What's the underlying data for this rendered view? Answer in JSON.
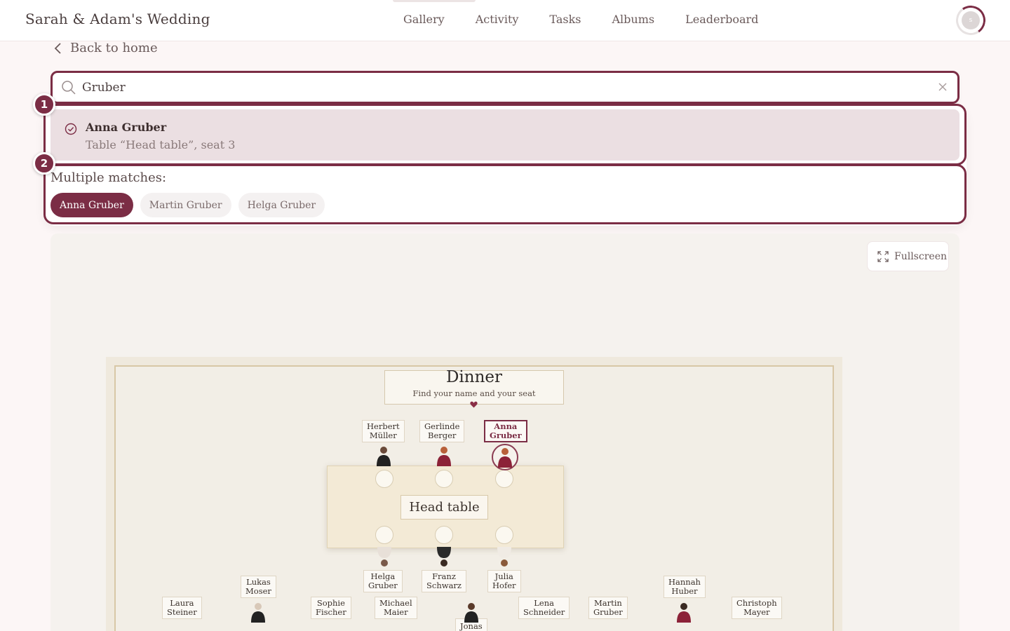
{
  "app": {
    "title": "Sarah & Adam's Wedding",
    "avatar_initial": "s"
  },
  "nav": {
    "items": [
      {
        "label": "Gallery"
      },
      {
        "label": "Activity"
      },
      {
        "label": "Tasks"
      },
      {
        "label": "Albums"
      },
      {
        "label": "Leaderboard"
      }
    ]
  },
  "back": {
    "label": "Back to home"
  },
  "search": {
    "value": "Gruber"
  },
  "result": {
    "name": "Anna Gruber",
    "seat": "Table “Head table”, seat 3"
  },
  "badges": {
    "one": "1",
    "two": "2"
  },
  "matches": {
    "label": "Multiple matches:",
    "chips": [
      {
        "label": "Anna Gruber",
        "active": true
      },
      {
        "label": "Martin Gruber",
        "active": false
      },
      {
        "label": "Helga Gruber",
        "active": false
      }
    ]
  },
  "fullscreen": {
    "label": "Fullscreen"
  },
  "seating": {
    "title": "Dinner",
    "subtitle": "Find your name and your seat",
    "table_label": "Head table",
    "top_guests": [
      {
        "first": "Herbert",
        "last": "Müller"
      },
      {
        "first": "Gerlinde",
        "last": "Berger"
      },
      {
        "first": "Anna",
        "last": "Gruber"
      }
    ],
    "bottom_guests": [
      {
        "first": "Helga",
        "last": "Gruber"
      },
      {
        "first": "Franz",
        "last": "Schwarz"
      },
      {
        "first": "Julia",
        "last": "Hofer"
      }
    ],
    "lower_guests": [
      {
        "first": "Laura",
        "last": "Steiner"
      },
      {
        "first": "Lukas",
        "last": "Moser"
      },
      {
        "first": "Sophie",
        "last": "Fischer"
      },
      {
        "first": "Michael",
        "last": "Maier"
      },
      {
        "first": "Jonas",
        "last": ""
      },
      {
        "first": "Lena",
        "last": "Schneider"
      },
      {
        "first": "Martin",
        "last": "Gruber"
      },
      {
        "first": "Hannah",
        "last": "Huber"
      },
      {
        "first": "Christoph",
        "last": "Mayer"
      }
    ]
  },
  "colors": {
    "accent": "#7b2d45",
    "background": "#fcf6f6",
    "selected_result": "#ebdfe2"
  }
}
